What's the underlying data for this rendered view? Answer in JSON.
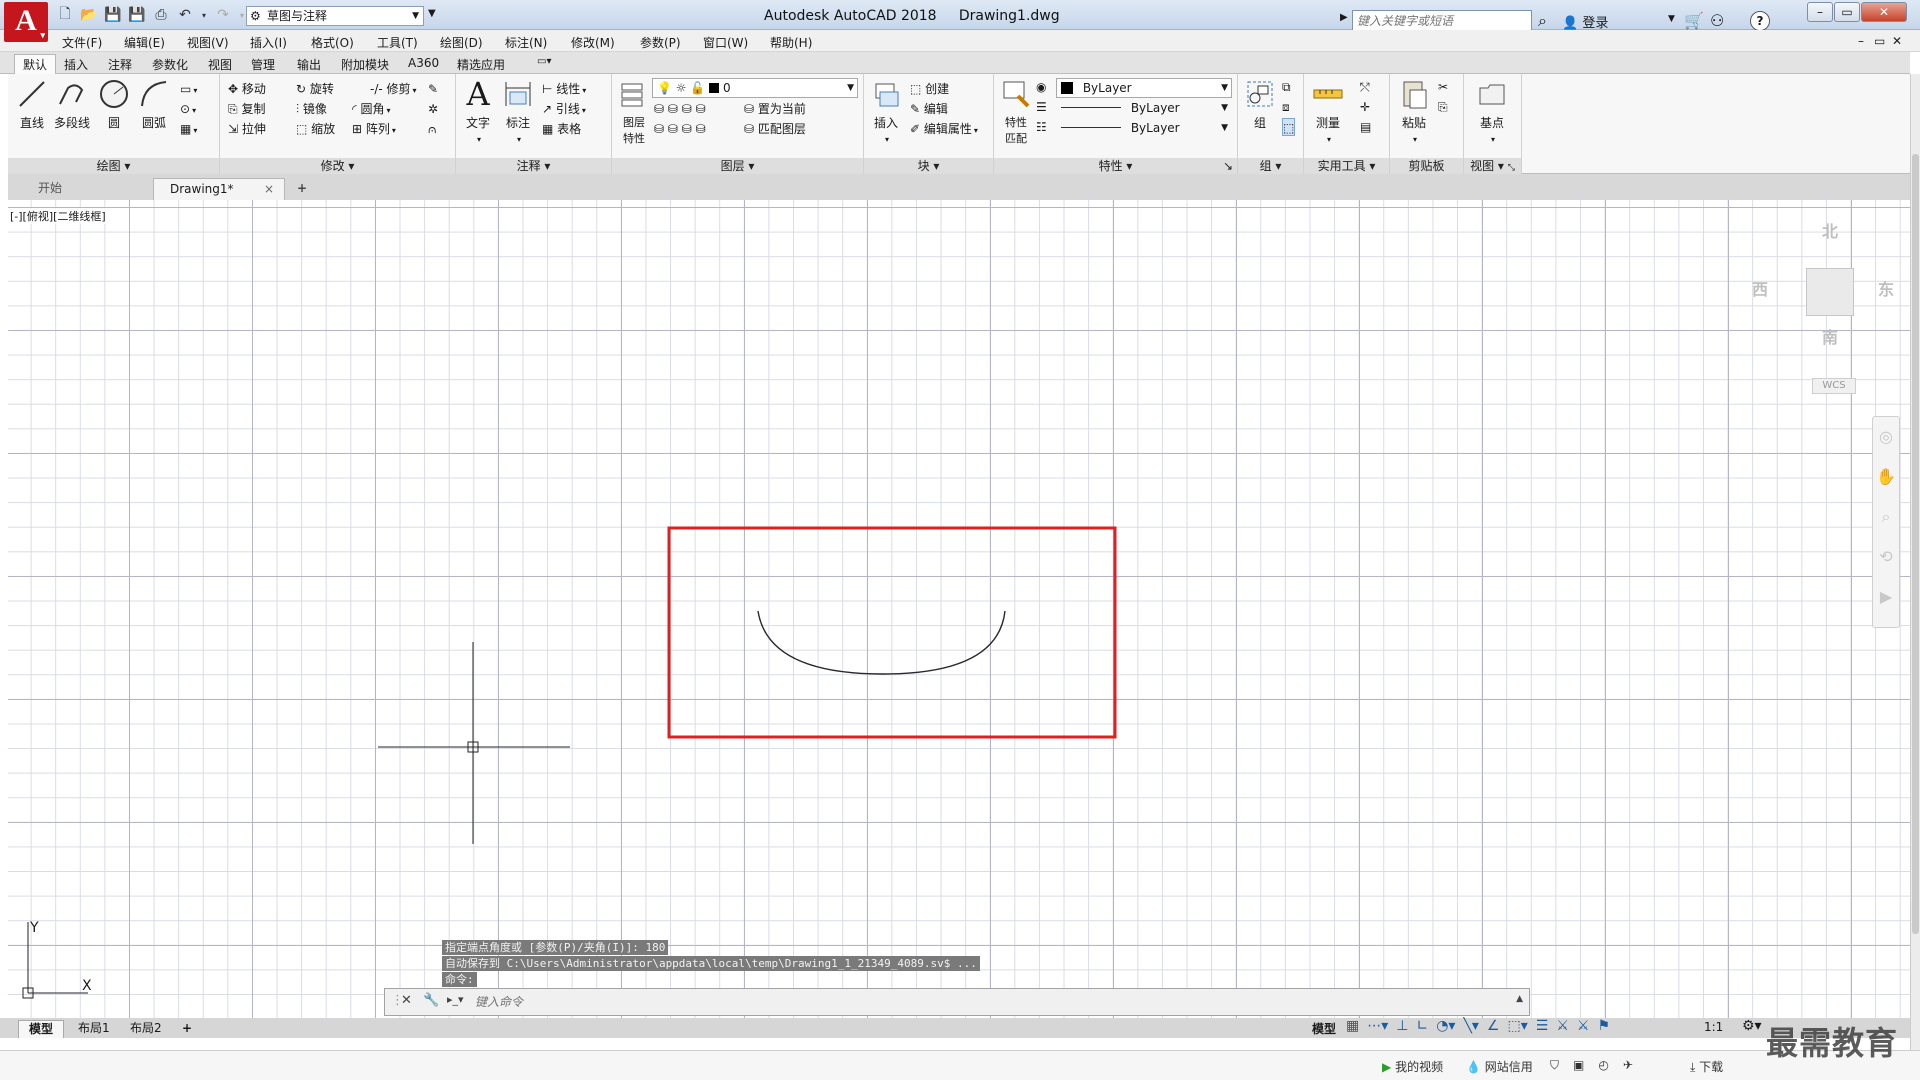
{
  "window": {
    "title": "Autodesk AutoCAD 2018",
    "document": "Drawing1.dwg",
    "workspace": "草图与注释",
    "search_placeholder": "键入关键字或短语",
    "login": "登录",
    "help": "?",
    "min": "–",
    "restore": "▭",
    "close": "✕"
  },
  "menu": [
    "文件(F)",
    "编辑(E)",
    "视图(V)",
    "插入(I)",
    "格式(O)",
    "工具(T)",
    "绘图(D)",
    "标注(N)",
    "修改(M)",
    "参数(P)",
    "窗口(W)",
    "帮助(H)"
  ],
  "ribbon_tabs": [
    "默认",
    "插入",
    "注释",
    "参数化",
    "视图",
    "管理",
    "输出",
    "附加模块",
    "A360",
    "精选应用"
  ],
  "ribbon": {
    "draw": {
      "title": "绘图",
      "line": "直线",
      "polyline": "多段线",
      "circle": "圆",
      "arc": "圆弧"
    },
    "modify": {
      "title": "修改",
      "move": "移动",
      "rotate": "旋转",
      "trim": "修剪",
      "copy": "复制",
      "mirror": "镜像",
      "fillet": "圆角",
      "stretch": "拉伸",
      "scale": "缩放",
      "array": "阵列"
    },
    "annotation": {
      "title": "注释",
      "text": "文字",
      "dimension": "标注",
      "linear": "线性",
      "leader": "引线",
      "table": "表格"
    },
    "layers": {
      "title": "图层",
      "properties_l1": "图层",
      "properties_l2": "特性",
      "layer_value": "0",
      "set_current": "置为当前",
      "match_layer": "匹配图层"
    },
    "block": {
      "title": "块",
      "insert": "插入",
      "create": "创建",
      "edit": "编辑",
      "edit_attr": "编辑属性"
    },
    "properties": {
      "title": "特性",
      "match_l1": "特性",
      "match_l2": "匹配",
      "color": "ByLayer",
      "linetype": "ByLayer",
      "lineweight": "ByLayer"
    },
    "groups": {
      "title": "组",
      "group": "组"
    },
    "utilities": {
      "title": "实用工具",
      "measure": "测量"
    },
    "clipboard": {
      "title": "剪贴板",
      "paste": "粘贴"
    },
    "view": {
      "title": "视图",
      "base": "基点"
    }
  },
  "doc_tabs": {
    "start": "开始",
    "drawing": "Drawing1*",
    "close": "×",
    "new": "+"
  },
  "viewport": {
    "label": "[-][俯视][二维线框]",
    "north": "北",
    "south": "南",
    "east": "东",
    "west": "西",
    "wcs": "WCS",
    "ucs_x": "X",
    "ucs_y": "Y"
  },
  "command": {
    "history": [
      "指定端点角度或 [参数(P)/夹角(I)]: 180",
      "自动保存到 C:\\Users\\Administrator\\appdata\\local\\temp\\Drawing1_1_21349_4089.sv$ ...",
      "命令:"
    ],
    "placeholder": "键入命令"
  },
  "layout_tabs": [
    "模型",
    "布局1",
    "布局2",
    "+"
  ],
  "status": {
    "model": "模型",
    "scale": "1:1"
  },
  "footer": {
    "video": "我的视频",
    "credit": "网站信用",
    "download": "下载"
  },
  "watermark": "最需教育",
  "colors": {
    "selection_rect": "#e02020",
    "arc": "#2a2a2a",
    "logo": "#c4161c"
  }
}
